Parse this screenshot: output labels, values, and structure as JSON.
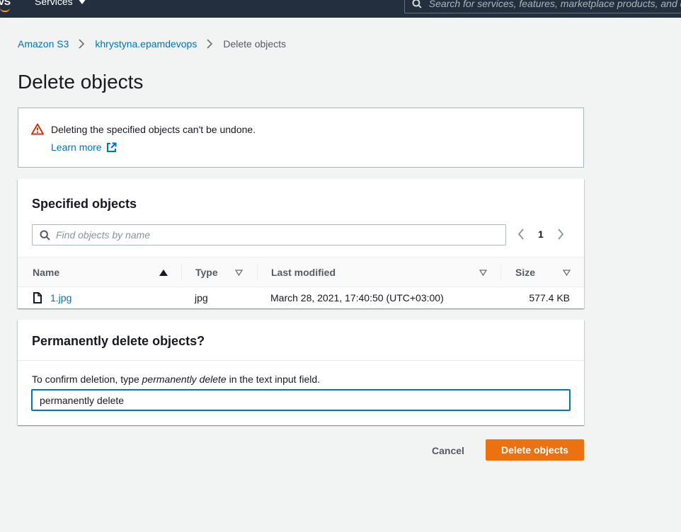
{
  "nav": {
    "logo_fragment": "vS",
    "services_label": "Services",
    "search_placeholder": "Search for services, features, marketplace products, and d"
  },
  "breadcrumb": {
    "items": [
      "Amazon S3",
      "khrystyna.epamdevops"
    ],
    "current": "Delete objects"
  },
  "page_title": "Delete objects",
  "alert": {
    "message": "Deleting the specified objects can't be undone.",
    "link_label": "Learn more",
    "color": "#d13212"
  },
  "objects": {
    "heading": "Specified objects",
    "filter_placeholder": "Find objects by name",
    "page_number": "1",
    "columns": [
      "Name",
      "Type",
      "Last modified",
      "Size"
    ],
    "rows": [
      {
        "name": "1.jpg",
        "type": "jpg",
        "last_modified": "March 28, 2021, 17:40:50 (UTC+03:00)",
        "size": "577.4 KB"
      }
    ]
  },
  "confirm": {
    "heading": "Permanently delete objects?",
    "instruction_before": "To confirm deletion, type ",
    "instruction_em": "permanently delete",
    "instruction_after": " in the text input field.",
    "input_value": "permanently delete"
  },
  "actions": {
    "cancel_label": "Cancel",
    "delete_label": "Delete objects",
    "accent": "#ec7211"
  }
}
